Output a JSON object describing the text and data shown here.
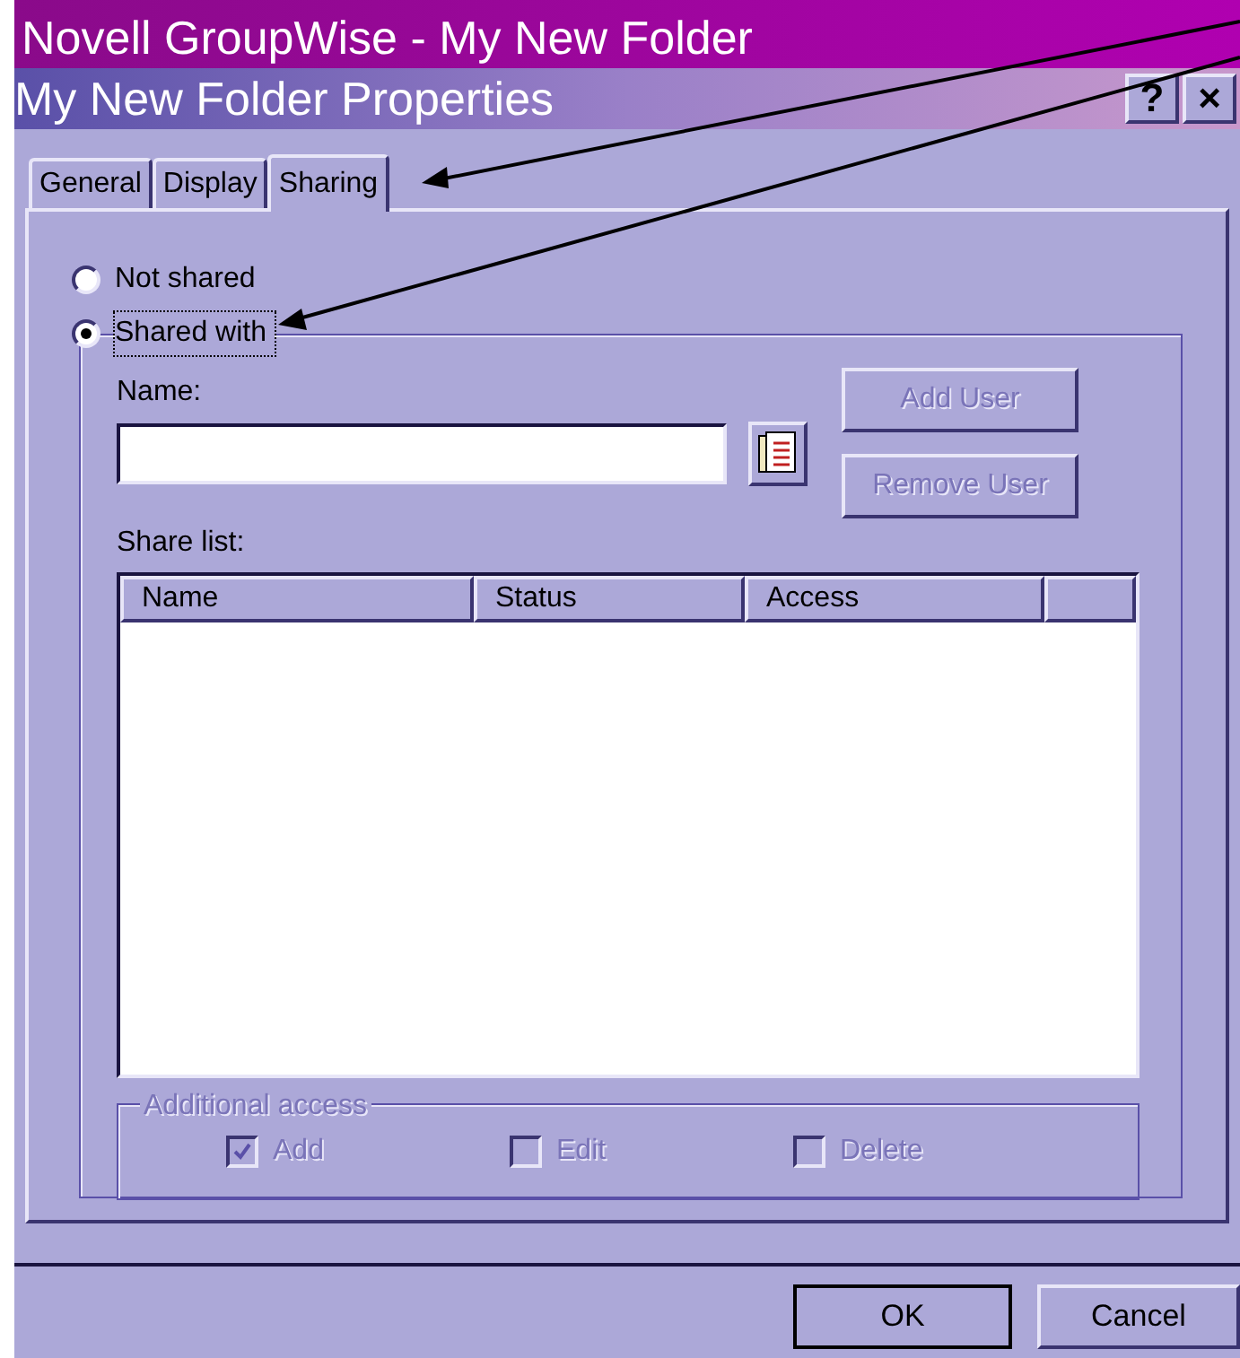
{
  "parent_window": {
    "title": "Novell GroupWise - My New Folder"
  },
  "dialog": {
    "title": "My New Folder Properties",
    "title_buttons": [
      "?",
      "×"
    ]
  },
  "tabs": [
    {
      "label": "General",
      "selected": false
    },
    {
      "label": "Display",
      "selected": false
    },
    {
      "label": "Sharing",
      "selected": true
    }
  ],
  "sharing": [
    {
      "label": "Not shared",
      "selected": false
    },
    {
      "label": "Shared with",
      "selected": true
    }
  ],
  "name_field": {
    "label": "Name:"
  },
  "user_buttons": [
    {
      "label": "Add User",
      "disabled": true
    },
    {
      "label": "Remove User",
      "disabled": true
    }
  ],
  "share_list": {
    "label": "Share list:",
    "columns": [
      "Name",
      "Status",
      "Access"
    ]
  },
  "additional_access": {
    "title": "Additional access",
    "disabled": true,
    "options": [
      {
        "label": "Add",
        "checked": true
      },
      {
        "label": "Edit",
        "checked": false
      },
      {
        "label": "Delete",
        "checked": false
      }
    ]
  },
  "buttons": [
    "OK",
    "Cancel"
  ]
}
